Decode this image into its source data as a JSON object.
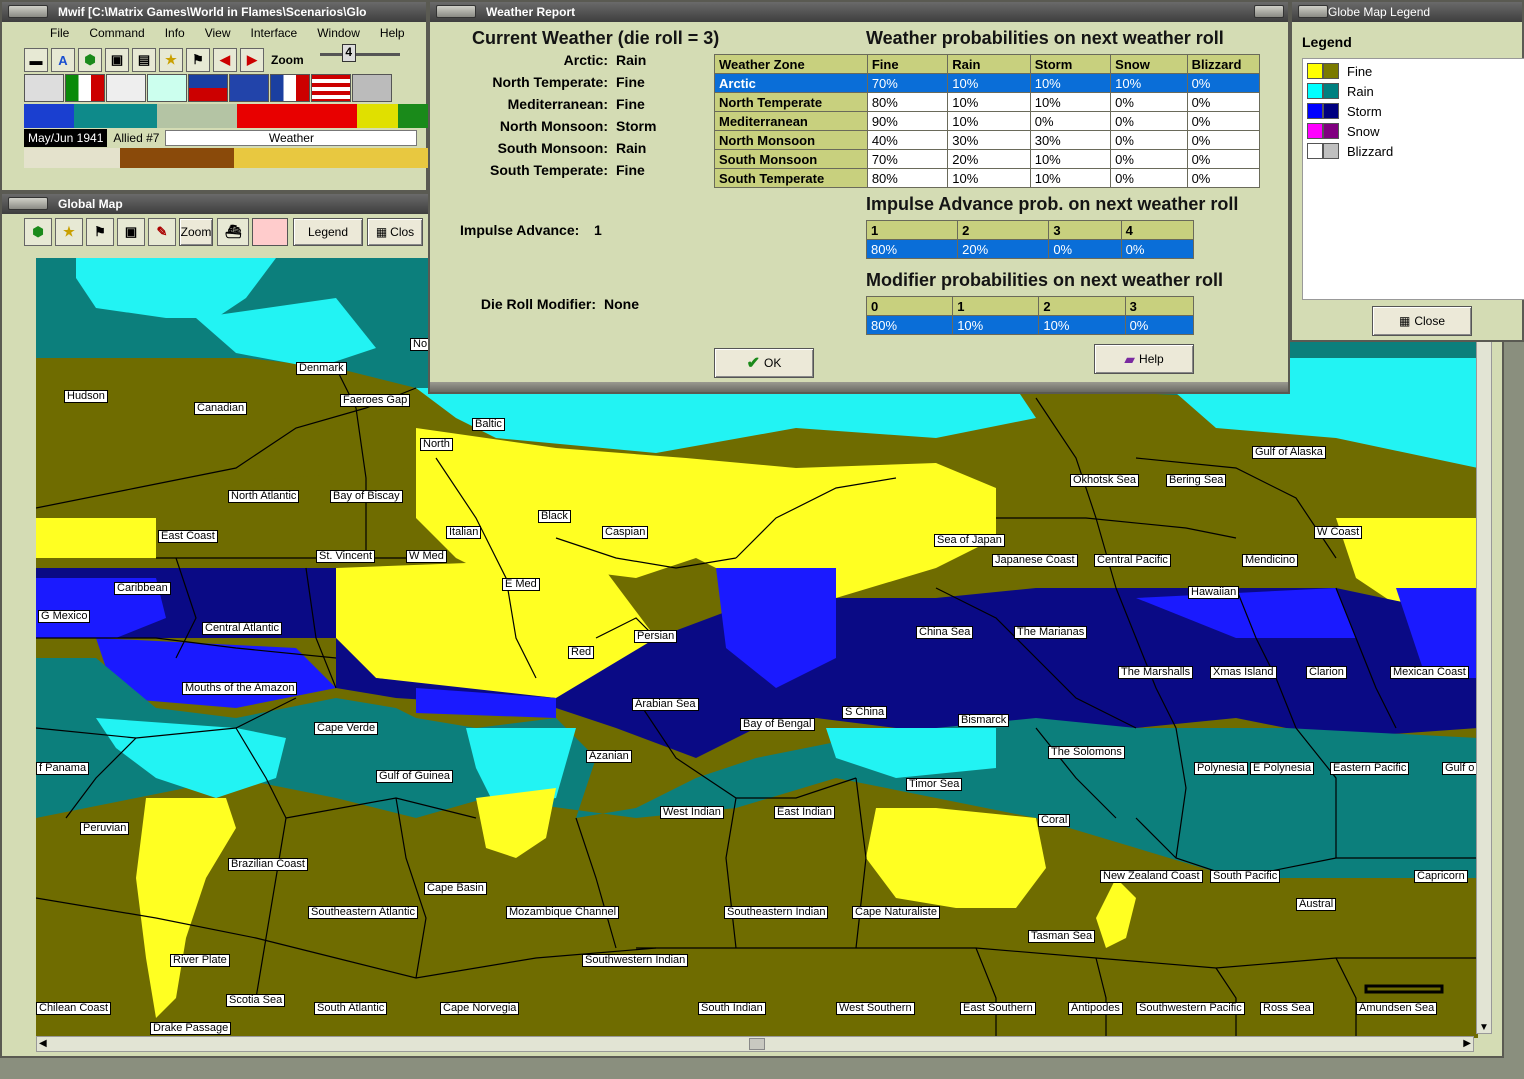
{
  "main_window": {
    "title": "Mwif [C:\\Matrix Games\\World in Flames\\Scenarios\\Glo",
    "menu": [
      "File",
      "Command",
      "Info",
      "View",
      "Interface",
      "Window",
      "Help"
    ],
    "zoom_label": "Zoom",
    "zoom_value": "4",
    "date": "May/Jun 1941",
    "turn": "Allied #7",
    "weather_field": "Weather"
  },
  "global_map": {
    "title": "Global Map",
    "zoom_btn": "Zoom",
    "legend_btn": "Legend",
    "close_btn": "Clos",
    "labels": [
      {
        "text": "Denmark"
      },
      {
        "text": "Hudson"
      },
      {
        "text": "Canadian"
      },
      {
        "text": "Faeroes Gap"
      },
      {
        "text": "No"
      },
      {
        "text": "Baltic"
      },
      {
        "text": "North"
      },
      {
        "text": "North Atlantic"
      },
      {
        "text": "Bay of Biscay"
      },
      {
        "text": "Black"
      },
      {
        "text": "Caspian"
      },
      {
        "text": "Italian"
      },
      {
        "text": "East Coast"
      },
      {
        "text": "St. Vincent"
      },
      {
        "text": "W Med"
      },
      {
        "text": "E Med"
      },
      {
        "text": "Caribbean"
      },
      {
        "text": "G Mexico"
      },
      {
        "text": "Central Atlantic"
      },
      {
        "text": "Persian"
      },
      {
        "text": "Red"
      },
      {
        "text": "Mouths of the Amazon"
      },
      {
        "text": "Arabian Sea"
      },
      {
        "text": "Cape Verde"
      },
      {
        "text": "Azanian"
      },
      {
        "text": "f Panama"
      },
      {
        "text": "Gulf of Guinea"
      },
      {
        "text": "Peruvian"
      },
      {
        "text": "West Indian"
      },
      {
        "text": "Brazilian Coast"
      },
      {
        "text": "Cape Basin"
      },
      {
        "text": "Southeastern Atlantic"
      },
      {
        "text": "Mozambique Channel"
      },
      {
        "text": "Southwestern Indian"
      },
      {
        "text": "River Plate"
      },
      {
        "text": "Scotia Sea"
      },
      {
        "text": "Chilean Coast"
      },
      {
        "text": "South Atlantic"
      },
      {
        "text": "Cape Norvegia"
      },
      {
        "text": "Drake Passage"
      },
      {
        "text": "Gulf of Alaska"
      },
      {
        "text": "Okhotsk Sea"
      },
      {
        "text": "Bering Sea"
      },
      {
        "text": "W Coast"
      },
      {
        "text": "Sea of Japan"
      },
      {
        "text": "Japanese Coast"
      },
      {
        "text": "Central Pacific"
      },
      {
        "text": "Mendicino"
      },
      {
        "text": "Hawaiian"
      },
      {
        "text": "China Sea"
      },
      {
        "text": "The Marianas"
      },
      {
        "text": "The Marshalls"
      },
      {
        "text": "Xmas Island"
      },
      {
        "text": "Clarion"
      },
      {
        "text": "Mexican Coast"
      },
      {
        "text": "Bay of Bengal"
      },
      {
        "text": "S China"
      },
      {
        "text": "Bismarck"
      },
      {
        "text": "The Solomons"
      },
      {
        "text": "Polynesia"
      },
      {
        "text": "E Polynesia"
      },
      {
        "text": "Eastern Pacific"
      },
      {
        "text": "Gulf o"
      },
      {
        "text": "Timor Sea"
      },
      {
        "text": "East Indian"
      },
      {
        "text": "Coral"
      },
      {
        "text": "New Zealand Coast"
      },
      {
        "text": "South Pacific"
      },
      {
        "text": "Capricorn"
      },
      {
        "text": "Austral"
      },
      {
        "text": "Southeastern Indian"
      },
      {
        "text": "Cape Naturaliste"
      },
      {
        "text": "Tasman Sea"
      },
      {
        "text": "South Indian"
      },
      {
        "text": "West Southern"
      },
      {
        "text": "East Southern"
      },
      {
        "text": "Antipodes"
      },
      {
        "text": "Southwestern Pacific"
      },
      {
        "text": "Ross Sea"
      },
      {
        "text": "Amundsen Sea"
      }
    ]
  },
  "weather_report": {
    "title": "Weather Report",
    "current_title": "Current Weather (die roll = 3)",
    "zones": [
      {
        "name": "Arctic:",
        "value": "Rain"
      },
      {
        "name": "North Temperate:",
        "value": "Fine"
      },
      {
        "name": "Mediterranean:",
        "value": "Fine"
      },
      {
        "name": "North Monsoon:",
        "value": "Storm"
      },
      {
        "name": "South Monsoon:",
        "value": "Rain"
      },
      {
        "name": "South Temperate:",
        "value": "Fine"
      }
    ],
    "impulse_label": "Impulse Advance:",
    "impulse_value": "1",
    "die_mod_label": "Die Roll Modifier:",
    "die_mod_value": "None",
    "prob_title": "Weather probabilities on next weather roll",
    "prob_headers": [
      "Weather Zone",
      "Fine",
      "Rain",
      "Storm",
      "Snow",
      "Blizzard"
    ],
    "prob_rows": [
      [
        "Arctic",
        "70%",
        "10%",
        "10%",
        "10%",
        "0%"
      ],
      [
        "North Temperate",
        "80%",
        "10%",
        "10%",
        "0%",
        "0%"
      ],
      [
        "Mediterranean",
        "90%",
        "10%",
        "0%",
        "0%",
        "0%"
      ],
      [
        "North Monsoon",
        "40%",
        "30%",
        "30%",
        "0%",
        "0%"
      ],
      [
        "South Monsoon",
        "70%",
        "20%",
        "10%",
        "0%",
        "0%"
      ],
      [
        "South Temperate",
        "80%",
        "10%",
        "10%",
        "0%",
        "0%"
      ]
    ],
    "impulse_title": "Impulse Advance prob. on next weather roll",
    "impulse_headers": [
      "1",
      "2",
      "3",
      "4"
    ],
    "impulse_values": [
      "80%",
      "20%",
      "0%",
      "0%"
    ],
    "modifier_title": "Modifier probabilities on next weather roll",
    "modifier_headers": [
      "0",
      "1",
      "2",
      "3"
    ],
    "modifier_values": [
      "80%",
      "10%",
      "10%",
      "0%"
    ],
    "ok_btn": "OK",
    "help_btn": "Help"
  },
  "legend": {
    "title": "Globe Map Legend",
    "heading": "Legend",
    "items": [
      {
        "label": "Fine",
        "c1": "#ffff00",
        "c2": "#7a7a00"
      },
      {
        "label": "Rain",
        "c1": "#00ffff",
        "c2": "#008080"
      },
      {
        "label": "Storm",
        "c1": "#0000ff",
        "c2": "#000080"
      },
      {
        "label": "Snow",
        "c1": "#ff00ff",
        "c2": "#800080"
      },
      {
        "label": "Blizzard",
        "c1": "#ffffff",
        "c2": "#c0c0c0"
      }
    ],
    "close_btn": "Close"
  },
  "colors": {
    "fine_dark": "#6f6c00",
    "fine_light": "#ffff22",
    "rain_dark": "#0c7f7c",
    "rain_light": "#22f3f3",
    "storm_dark": "#0a0a85",
    "storm_light": "#1a1aff",
    "selected_row": "#0a6ed8",
    "header_cell": "#c8d07e"
  }
}
